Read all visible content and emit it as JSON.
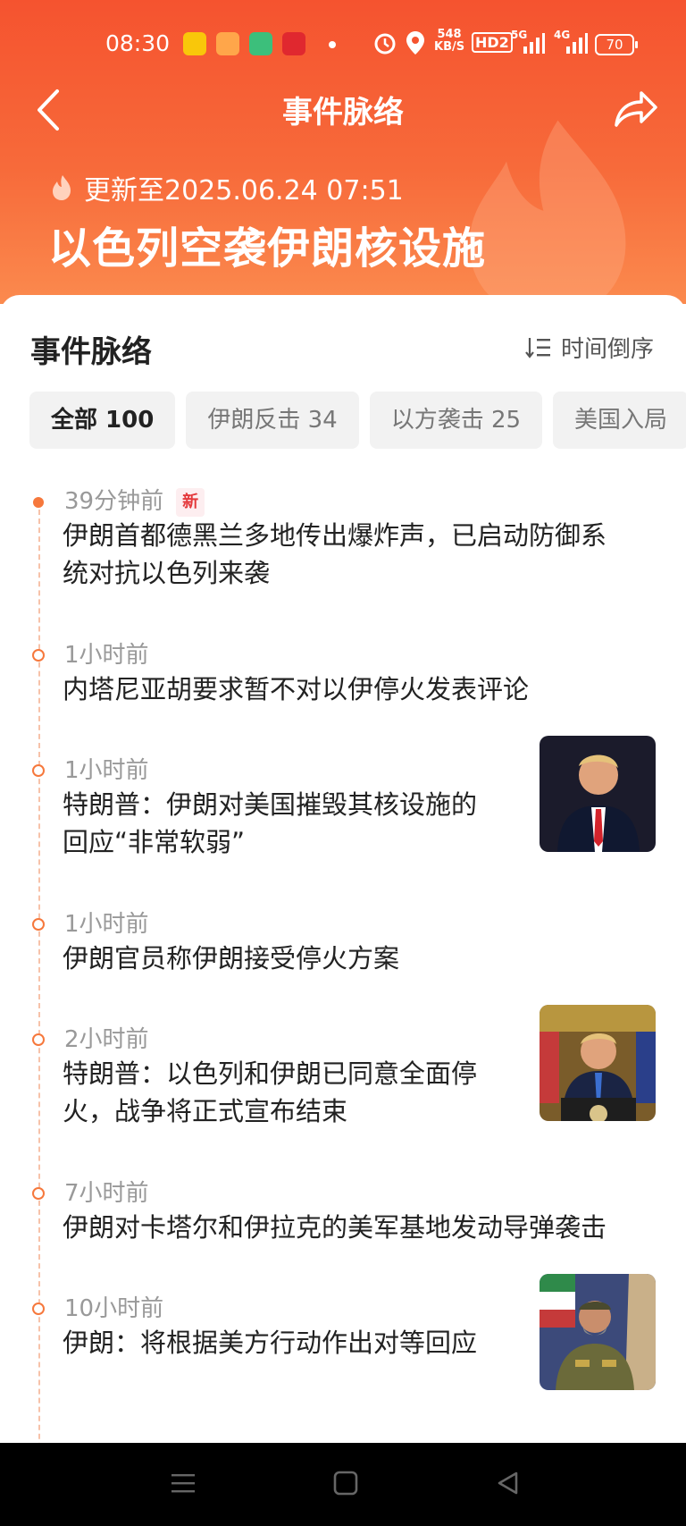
{
  "status_bar": {
    "time": "08:30",
    "net_speed_value": "548",
    "net_speed_unit": "KB/S",
    "hd_label": "HD2",
    "signal_5g": "5G",
    "signal_4g": "4G",
    "battery": "70"
  },
  "header": {
    "title": "事件脉络",
    "update_text": "更新至2025.06.24 07:51",
    "event_title": "以色列空袭伊朗核设施",
    "accent_color": "#f5532f"
  },
  "section": {
    "title": "事件脉络",
    "sort_label": "时间倒序"
  },
  "tabs": [
    {
      "label": "全部 100"
    },
    {
      "label": "伊朗反击 34"
    },
    {
      "label": "以方袭击 25"
    },
    {
      "label": "美国入局"
    }
  ],
  "timeline": [
    {
      "time": "39分钟前",
      "badge": "新",
      "text_lines": [
        "伊朗首都德黑兰多地传出爆炸声，已启动防御系",
        "统对抗以色列来袭"
      ]
    },
    {
      "time": "1小时前",
      "text_lines": [
        "内塔尼亚胡要求暂不对以伊停火发表评论"
      ]
    },
    {
      "time": "1小时前",
      "text_lines": [
        "特朗普：伊朗对美国摧毁其核设施的",
        "回应“非常软弱”"
      ],
      "thumb": "trump-speech-photo"
    },
    {
      "time": "1小时前",
      "text_lines": [
        "伊朗官员称伊朗接受停火方案"
      ]
    },
    {
      "time": "2小时前",
      "text_lines": [
        "特朗普：以色列和伊朗已同意全面停",
        "火，战争将正式宣布结束"
      ],
      "thumb": "trump-podium-photo"
    },
    {
      "time": "7小时前",
      "text_lines": [
        "伊朗对卡塔尔和伊拉克的美军基地发动导弹袭击"
      ]
    },
    {
      "time": "10小时前",
      "text_lines": [
        "伊朗：将根据美方行动作出对等回应"
      ],
      "thumb": "iran-military-photo"
    }
  ]
}
